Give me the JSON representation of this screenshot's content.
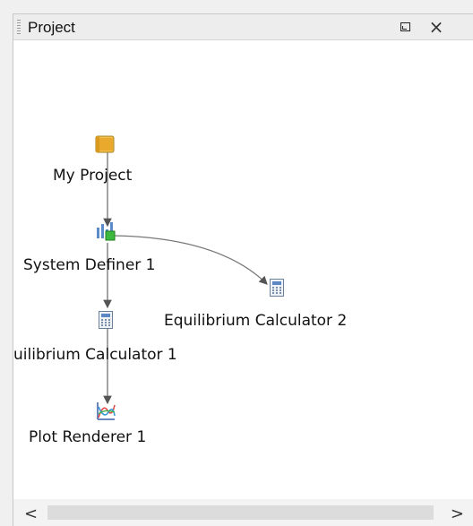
{
  "panel": {
    "title": "Project",
    "restore_icon": "restore-window-icon",
    "close_icon": "close-icon",
    "close_glyph": "×"
  },
  "nodes": [
    {
      "id": "my-project",
      "label": "My Project",
      "icon": "project-folder-icon"
    },
    {
      "id": "system-definer-1",
      "label": "System Definer 1",
      "icon": "system-definer-icon"
    },
    {
      "id": "equilibrium-calculator-1",
      "label": "uilibrium Calculator 1",
      "icon": "calculator-icon"
    },
    {
      "id": "equilibrium-calculator-2",
      "label": "Equilibrium Calculator 2",
      "icon": "calculator-icon"
    },
    {
      "id": "plot-renderer-1",
      "label": "Plot Renderer 1",
      "icon": "plot-icon"
    }
  ],
  "scrollbar": {
    "left_arrow": "<",
    "right_arrow": ">"
  }
}
